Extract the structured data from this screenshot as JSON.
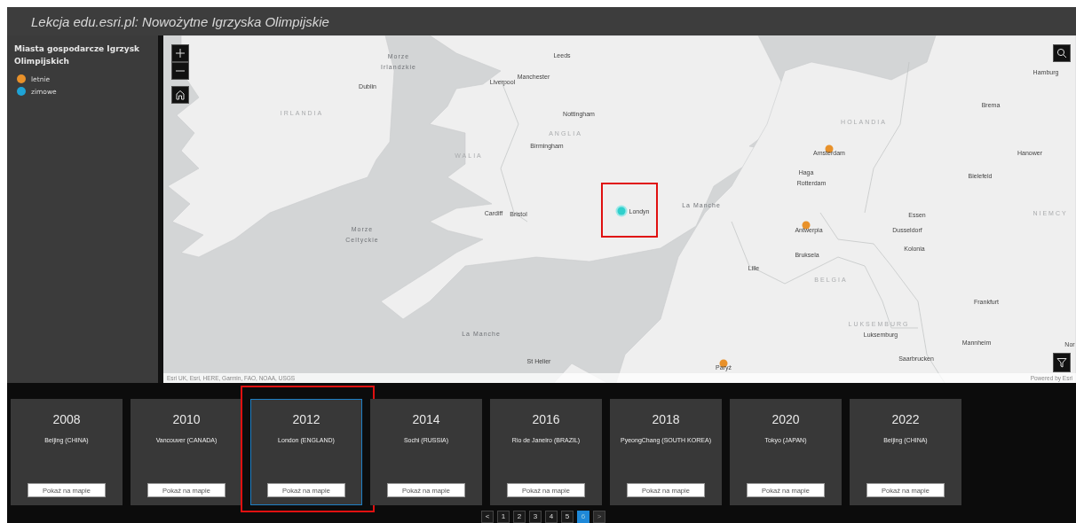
{
  "window": {
    "title": "Lekcja edu.esri.pl: Nowożytne Igrzyska Olimpijskie"
  },
  "legend": {
    "title": "Miasta gospodarcze Igrzysk Olimpijskich",
    "items": [
      {
        "label": "letnie",
        "color": "#e8912a"
      },
      {
        "label": "zimowe",
        "color": "#1ea3d6"
      }
    ]
  },
  "map": {
    "labels": [
      {
        "text": "Morze Irlandzkie",
        "kind": "sea"
      },
      {
        "text": "Leeds",
        "kind": "city"
      },
      {
        "text": "Manchester",
        "kind": "city"
      },
      {
        "text": "Liverpool",
        "kind": "city"
      },
      {
        "text": "Dublin",
        "kind": "city"
      },
      {
        "text": "IRLANDIA",
        "kind": "country"
      },
      {
        "text": "Nottingham",
        "kind": "city"
      },
      {
        "text": "ANGLIA",
        "kind": "country"
      },
      {
        "text": "Birmingham",
        "kind": "city"
      },
      {
        "text": "WALIA",
        "kind": "country"
      },
      {
        "text": "Cardiff",
        "kind": "city"
      },
      {
        "text": "Bristol",
        "kind": "city"
      },
      {
        "text": "Londyn",
        "kind": "city"
      },
      {
        "text": "La Manche",
        "kind": "sea"
      },
      {
        "text": "Morze Celtyckie",
        "kind": "sea"
      },
      {
        "text": "La Manche",
        "kind": "sea"
      },
      {
        "text": "St Helier",
        "kind": "city"
      },
      {
        "text": "Hamburg",
        "kind": "city"
      },
      {
        "text": "Brema",
        "kind": "city"
      },
      {
        "text": "HOLANDIA",
        "kind": "country"
      },
      {
        "text": "Amsterdam",
        "kind": "city"
      },
      {
        "text": "Hanower",
        "kind": "city"
      },
      {
        "text": "Haga",
        "kind": "city"
      },
      {
        "text": "Rotterdam",
        "kind": "city"
      },
      {
        "text": "Bielefeld",
        "kind": "city"
      },
      {
        "text": "Essen",
        "kind": "city"
      },
      {
        "text": "NIEMCY",
        "kind": "country"
      },
      {
        "text": "Antwerpia",
        "kind": "city"
      },
      {
        "text": "Dusseldorf",
        "kind": "city"
      },
      {
        "text": "Kolonia",
        "kind": "city"
      },
      {
        "text": "Bruksela",
        "kind": "city"
      },
      {
        "text": "Lille",
        "kind": "city"
      },
      {
        "text": "BELGIA",
        "kind": "country"
      },
      {
        "text": "Frankfurt",
        "kind": "city"
      },
      {
        "text": "LUKSEMBURG",
        "kind": "country"
      },
      {
        "text": "Luksemburg",
        "kind": "city"
      },
      {
        "text": "Mannheim",
        "kind": "city"
      },
      {
        "text": "Nor",
        "kind": "city"
      },
      {
        "text": "Saarbrucken",
        "kind": "city"
      },
      {
        "text": "Paryż",
        "kind": "city"
      }
    ],
    "markers": [
      {
        "color": "#2fd0cc",
        "highlighted": true
      },
      {
        "color": "#e8912a",
        "highlighted": false
      },
      {
        "color": "#e8912a",
        "highlighted": false
      },
      {
        "color": "#e8912a",
        "highlighted": false
      }
    ],
    "attribution": "Esri UK, Esri, HERE, Garmin, FAO, NOAA, USGS",
    "powered_by": "Powered by Esri"
  },
  "cards": [
    {
      "year": "2008",
      "city": "Beijing (CHINA)",
      "button": "Pokaż na mapie",
      "selected": false,
      "highlighted": false
    },
    {
      "year": "2010",
      "city": "Vancouver (CANADA)",
      "button": "Pokaż na mapie",
      "selected": false,
      "highlighted": false
    },
    {
      "year": "2012",
      "city": "London (ENGLAND)",
      "button": "Pokaż na mapie",
      "selected": true,
      "highlighted": true
    },
    {
      "year": "2014",
      "city": "Sochi (RUSSIA)",
      "button": "Pokaż na mapie",
      "selected": false,
      "highlighted": false
    },
    {
      "year": "2016",
      "city": "Rio de Janeiro (BRAZIL)",
      "button": "Pokaż na mapie",
      "selected": false,
      "highlighted": false
    },
    {
      "year": "2018",
      "city": "PyeongChang (SOUTH KOREA)",
      "button": "Pokaż na mapie",
      "selected": false,
      "highlighted": false
    },
    {
      "year": "2020",
      "city": "Tokyo (JAPAN)",
      "button": "Pokaż na mapie",
      "selected": false,
      "highlighted": false
    },
    {
      "year": "2022",
      "city": "Beijing (CHINA)",
      "button": "Pokaż na mapie",
      "selected": false,
      "highlighted": false
    }
  ],
  "pagination": {
    "previous": {
      "label": "<",
      "disabled": false
    },
    "pages": [
      {
        "label": "1",
        "selected": false
      },
      {
        "label": "2",
        "selected": false
      },
      {
        "label": "3",
        "selected": false
      },
      {
        "label": "4",
        "selected": false
      },
      {
        "label": "5",
        "selected": false
      },
      {
        "label": "6",
        "selected": true
      }
    ],
    "next": {
      "label": ">",
      "disabled": true
    }
  }
}
